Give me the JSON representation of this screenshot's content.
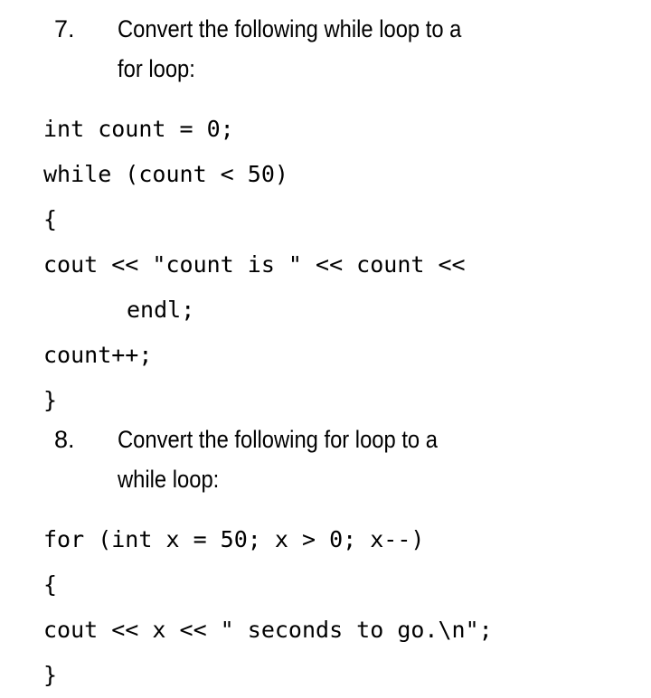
{
  "document": {
    "background_color": "#ffffff",
    "text_color": "#000000"
  },
  "items": [
    {
      "number": "7.",
      "prompt_line1": "Convert the following while loop to a",
      "prompt_line2": "for loop:",
      "code": [
        "int count = 0;",
        "while (count < 50)",
        "{",
        "cout << \"count is \" << count <<",
        "endl;",
        "count++;",
        "}"
      ]
    },
    {
      "number": "8.",
      "prompt_line1": "Convert the following for loop to a",
      "prompt_line2": "while loop:",
      "code": [
        "for (int x = 50; x > 0; x--)",
        "{",
        "cout << x << \" seconds to go.\\n\";",
        "}"
      ]
    }
  ]
}
